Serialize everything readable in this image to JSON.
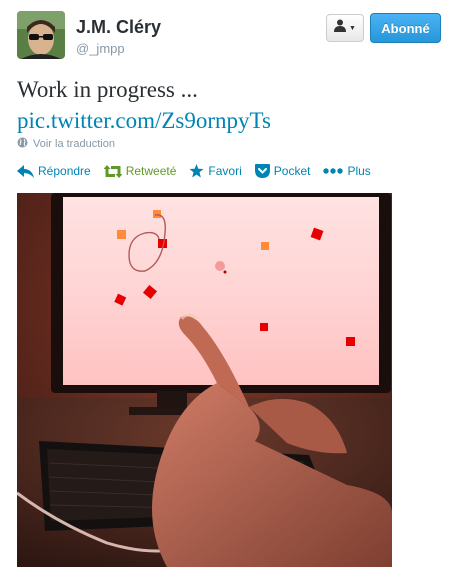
{
  "user": {
    "name": "J.M. Cléry",
    "handle": "@_jmpp"
  },
  "header": {
    "follow_label": "Abonné"
  },
  "tweet": {
    "text": "Work in progress ...",
    "link": "pic.twitter.com/Zs9ornpyTs",
    "translate_label": "Voir la traduction"
  },
  "actions": {
    "reply": "Répondre",
    "retweet": "Retweeté",
    "favorite": "Favori",
    "pocket": "Pocket",
    "more": "Plus"
  },
  "colors": {
    "link": "#0084b4",
    "retweeted": "#609928",
    "follow_button": "#2b9de2",
    "handle": "#8899a6"
  },
  "icons": {
    "reply": "reply-arrow-icon",
    "retweet": "retweet-icon",
    "favorite": "star-icon",
    "pocket": "pocket-icon",
    "more": "ellipsis-icon",
    "translate": "globe-icon",
    "user_menu": "person-icon"
  }
}
